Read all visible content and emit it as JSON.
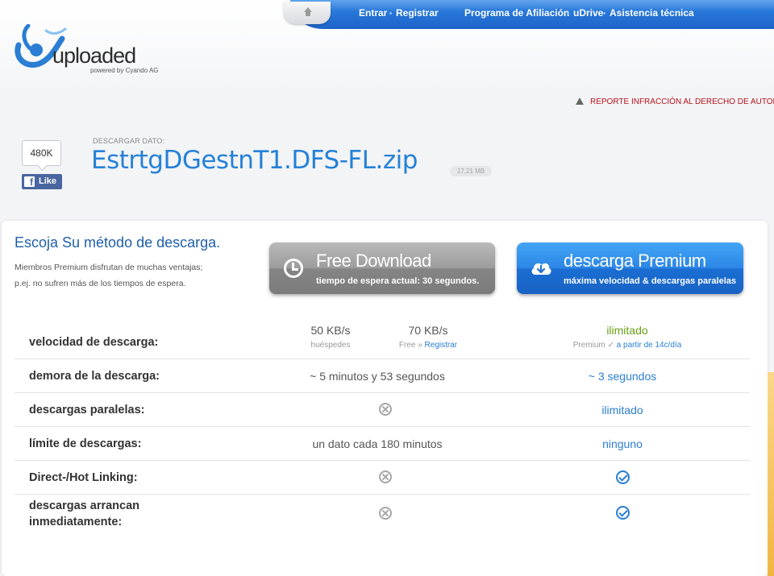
{
  "nav": {
    "login": "Entrar",
    "register": "Registrar",
    "affiliate": "Programa de Afiliación",
    "udrive": "uDrive",
    "support": "Asistencia técnica"
  },
  "logo": {
    "word": "uploaded",
    "tagline": "powered by Cyando AG"
  },
  "report": {
    "label": "REPORTE INFRACCIÓN AL DERECHO DE AUTOR"
  },
  "file": {
    "label": "DESCARGAR DATO:",
    "name": "EstrtgDGestnT1.DFS-FL.zip",
    "size": "17,21 MB"
  },
  "facebook": {
    "count": "480K",
    "like_label": "Like"
  },
  "intro": {
    "title": "Escoja Su método de descarga.",
    "line1": "Miembros Premium disfrutan de muchas ventajas;",
    "line2": "p.ej. no sufren más de los tiempos de espera."
  },
  "buttons": {
    "free_title": "Free Download",
    "free_sub": "tiempo de espera actual: 30 segundos.",
    "premium_title": "descarga Premium",
    "premium_sub": "máxima velocidad & descargas paralelas"
  },
  "table": {
    "speed": {
      "label": "velocidad de descarga:",
      "guest_speed": "50 KB/s",
      "guest_label": "huéspedes",
      "free_speed": "70 KB/s",
      "free_label": "Free",
      "free_arrow": "»",
      "free_register": "Registrar",
      "premium_value": "ilimitado",
      "premium_label": "Premium",
      "premium_check": "✓",
      "premium_price": "a partir de 14c/día"
    },
    "delay": {
      "label": "demora de la descarga:",
      "free": "~ 5 minutos y 53 segundos",
      "premium": "~ 3 segundos"
    },
    "parallel": {
      "label": "descargas paralelas:",
      "premium": "ilimitado"
    },
    "limit": {
      "label": "límite de descargas:",
      "free": "un dato cada 180 minutos",
      "premium": "ninguno"
    },
    "hotlink": {
      "label": "Direct-/Hot Linking:"
    },
    "instant": {
      "label_line1": "descargas arrancan",
      "label_line2": "inmediatamente:"
    }
  },
  "colors": {
    "accent_blue": "#2581d8",
    "nav_blue": "#1d63c8",
    "report_red": "#b3121b",
    "premium_green": "#6a9e16"
  }
}
